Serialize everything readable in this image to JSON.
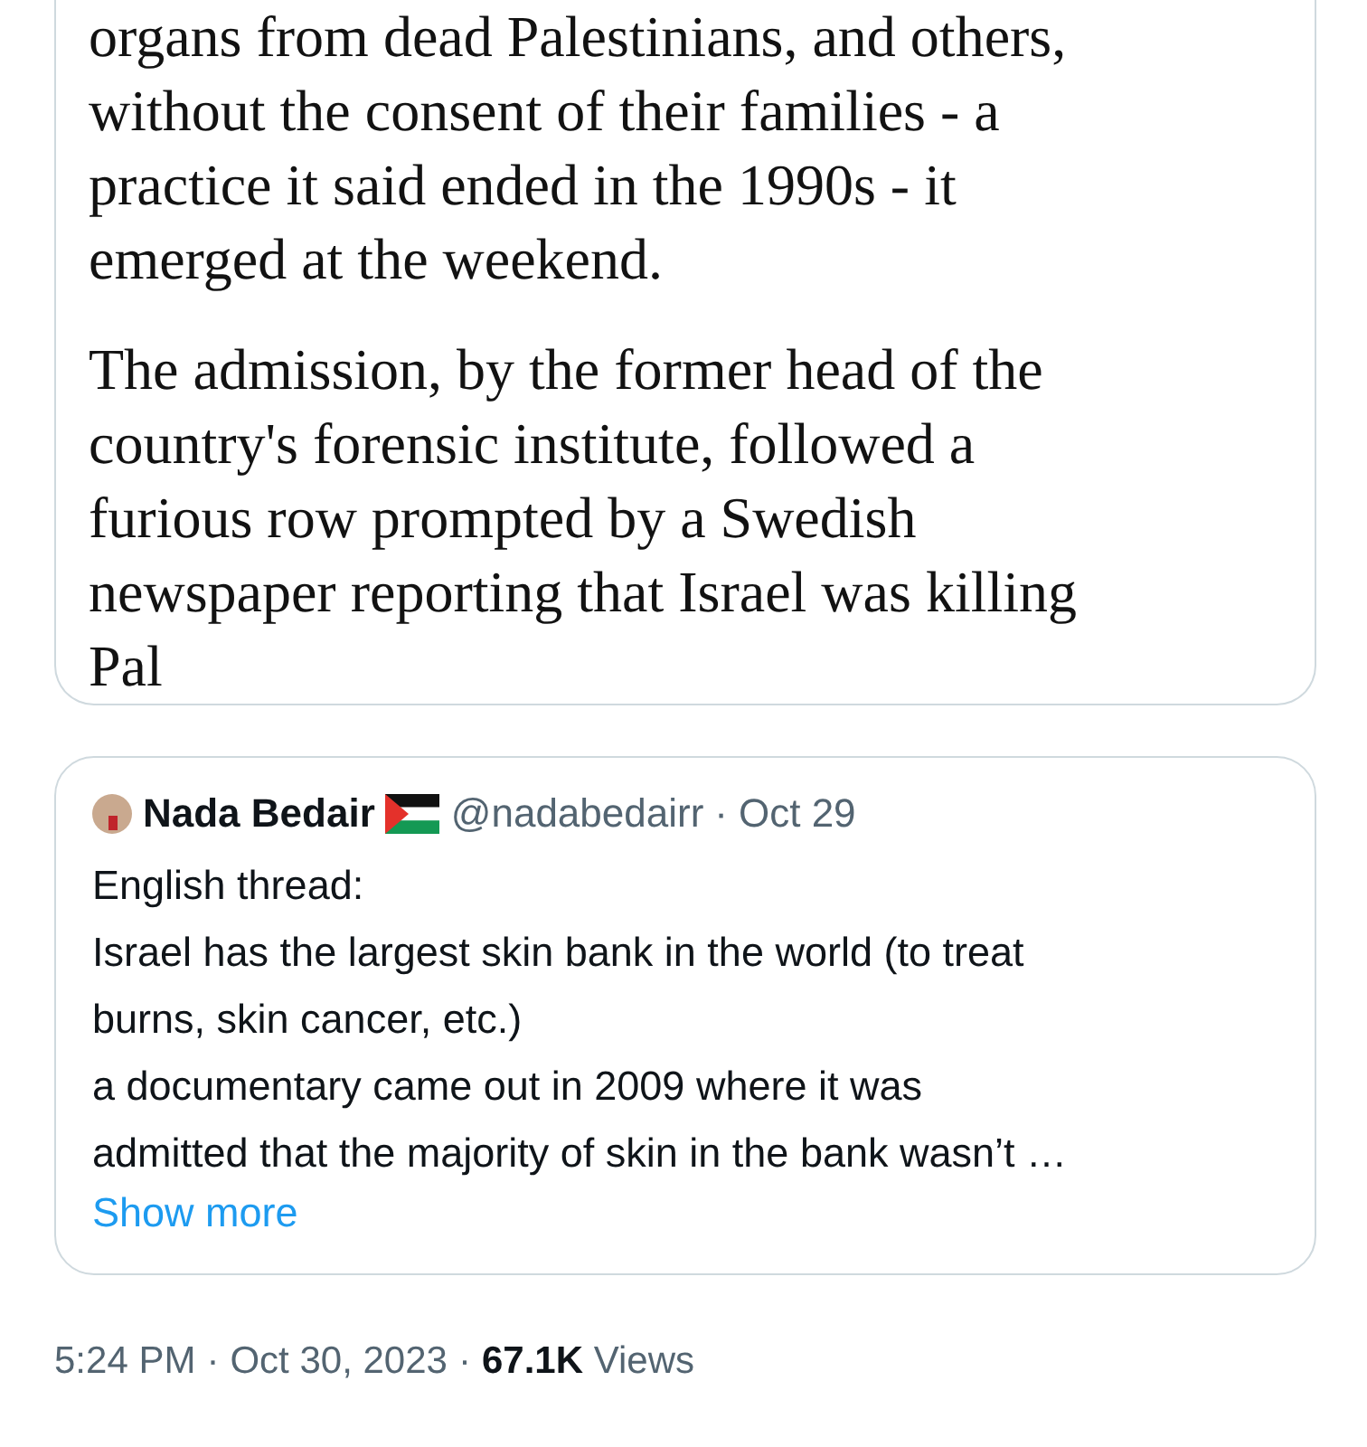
{
  "article_image": {
    "paragraphs": [
      {
        "lines": [
          "organs from dead Palestinians, and others,",
          "without the consent of their families - a",
          "practice it said ended in the 1990s - it",
          "emerged at the weekend."
        ]
      },
      {
        "lines": [
          "The admission, by the former head of the",
          "country's forensic institute, followed a",
          "furious row prompted by a Swedish",
          "newspaper reporting that Israel was killing",
          "Pal"
        ]
      }
    ]
  },
  "quoted_tweet": {
    "name": "Nada Bedair",
    "handle": "@nadabedairr",
    "separator": "·",
    "date": "Oct 29",
    "lines": [
      "English thread:",
      "Israel has the largest skin bank in the world (to treat",
      "burns, skin cancer, etc.)",
      "a documentary came out in 2009 where it was",
      "admitted that the majority of skin in the bank wasn’t …"
    ],
    "show_more": "Show more"
  },
  "meta": {
    "time": "5:24 PM",
    "separator_1": "·",
    "date": "Oct 30, 2023",
    "separator_2": "·",
    "views_count": "67.1K",
    "views_label": "Views"
  }
}
